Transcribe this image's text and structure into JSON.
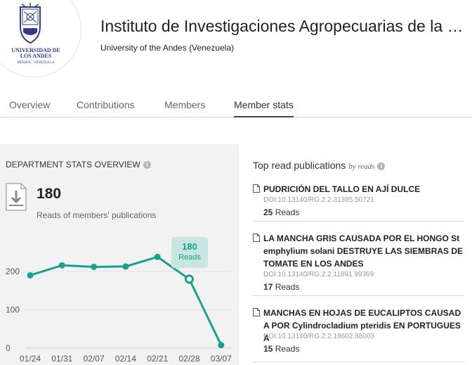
{
  "header": {
    "logo_text": "UNIVERSIDAD DE LOS ANDES",
    "logo_subtext": "MÉRIDA · VENEZUELA",
    "title": "Instituto de Investigaciones Agropecuarias de la U...",
    "subtitle": "University of the Andes (Venezuela)"
  },
  "tabs": [
    {
      "label": "Overview"
    },
    {
      "label": "Contributions"
    },
    {
      "label": "Members"
    },
    {
      "label": "Member stats",
      "active": true
    }
  ],
  "stats": {
    "heading": "DEPARTMENT STATS OVERVIEW",
    "info_icon": "info-icon",
    "total_reads": "180",
    "caption": "Reads of members' publications",
    "tooltip_value": "180",
    "tooltip_label": "Reads",
    "accent_color": "#17a18e"
  },
  "chart_data": {
    "type": "line",
    "categories": [
      "01/24",
      "01/31",
      "02/07",
      "02/14",
      "02/21",
      "02/28",
      "03/07"
    ],
    "values": [
      190,
      216,
      212,
      213,
      238,
      180,
      8
    ],
    "highlight_index": 5,
    "y_ticks": [
      0,
      100,
      200
    ],
    "ylim": [
      0,
      300
    ],
    "grid": true,
    "xlabel": "",
    "ylabel": ""
  },
  "publications": {
    "heading": "Top read publications",
    "heading_suffix": "by reads",
    "items": [
      {
        "title": "PUDRICIÓN DEL TALLO EN AJÍ DULCE",
        "doi": "DOI:10.13140/RG.2.2.31395.50721",
        "reads_count": "25",
        "reads_label": "Reads"
      },
      {
        "title": "LA MANCHA GRIS CAUSADA POR EL HONGO Stemphylium solani DESTRUYE LAS SIEMBRAS DE TOMATE EN LOS ANDES",
        "doi": "DOI:10.13140/RG.2.2.11891.99369",
        "reads_count": "17",
        "reads_label": "Reads"
      },
      {
        "title": "MANCHAS EN HOJAS DE EUCALIPTOS CAUSADA POR Cylindrocladium pteridis EN PORTUGUESA",
        "doi": "DOI:10.13140/RG.2.2.18602.88003",
        "reads_count": "15",
        "reads_label": "Reads"
      }
    ]
  }
}
